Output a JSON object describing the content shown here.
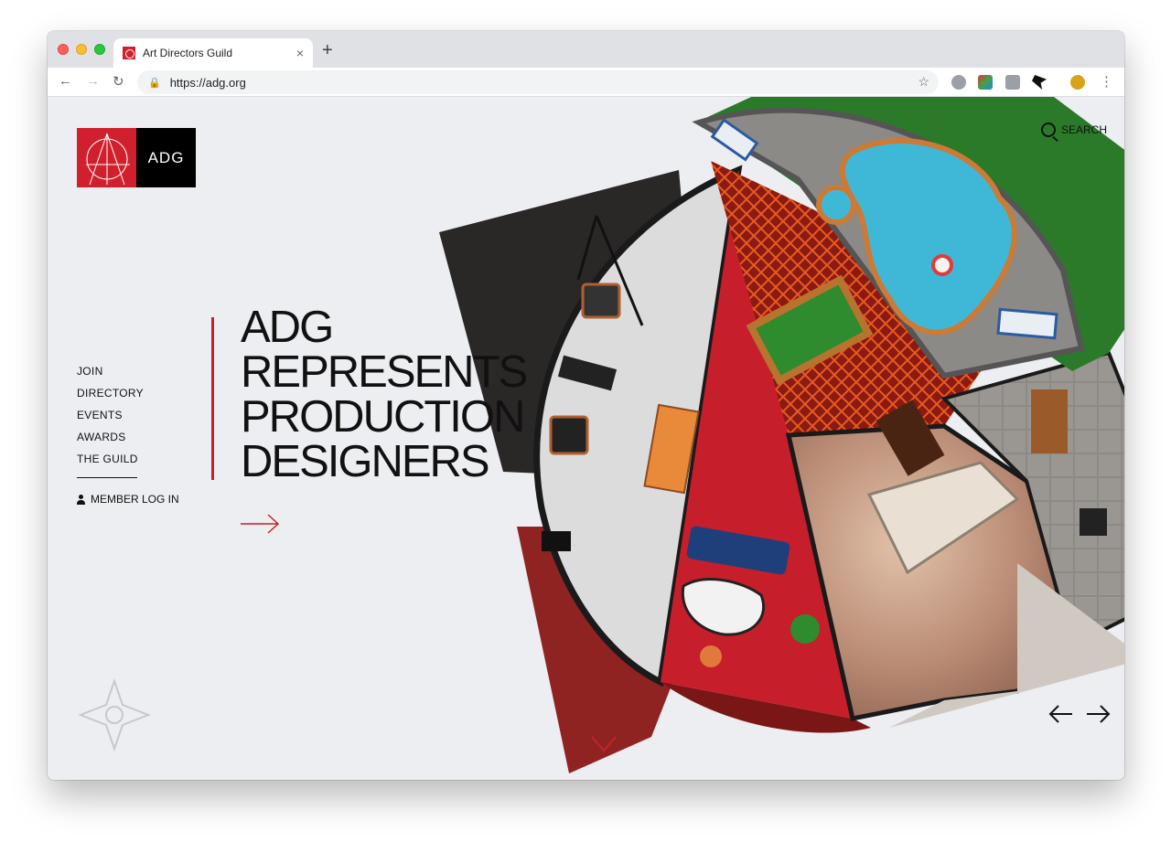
{
  "browser": {
    "tab_title": "Art Directors Guild",
    "url": "https://adg.org",
    "new_tab_label": "+",
    "close_label": "×"
  },
  "site": {
    "logo_text": "ADG",
    "search_label": "SEARCH",
    "nav": [
      "JOIN",
      "DIRECTORY",
      "EVENTS",
      "AWARDS",
      "THE GUILD"
    ],
    "login_label": "MEMBER LOG IN",
    "headline": [
      "ADG",
      "REPRESENTS",
      "PRODUCTION",
      "DESIGNERS"
    ],
    "prev_label": "←",
    "next_label": "→",
    "accent_color": "#c8202a"
  }
}
